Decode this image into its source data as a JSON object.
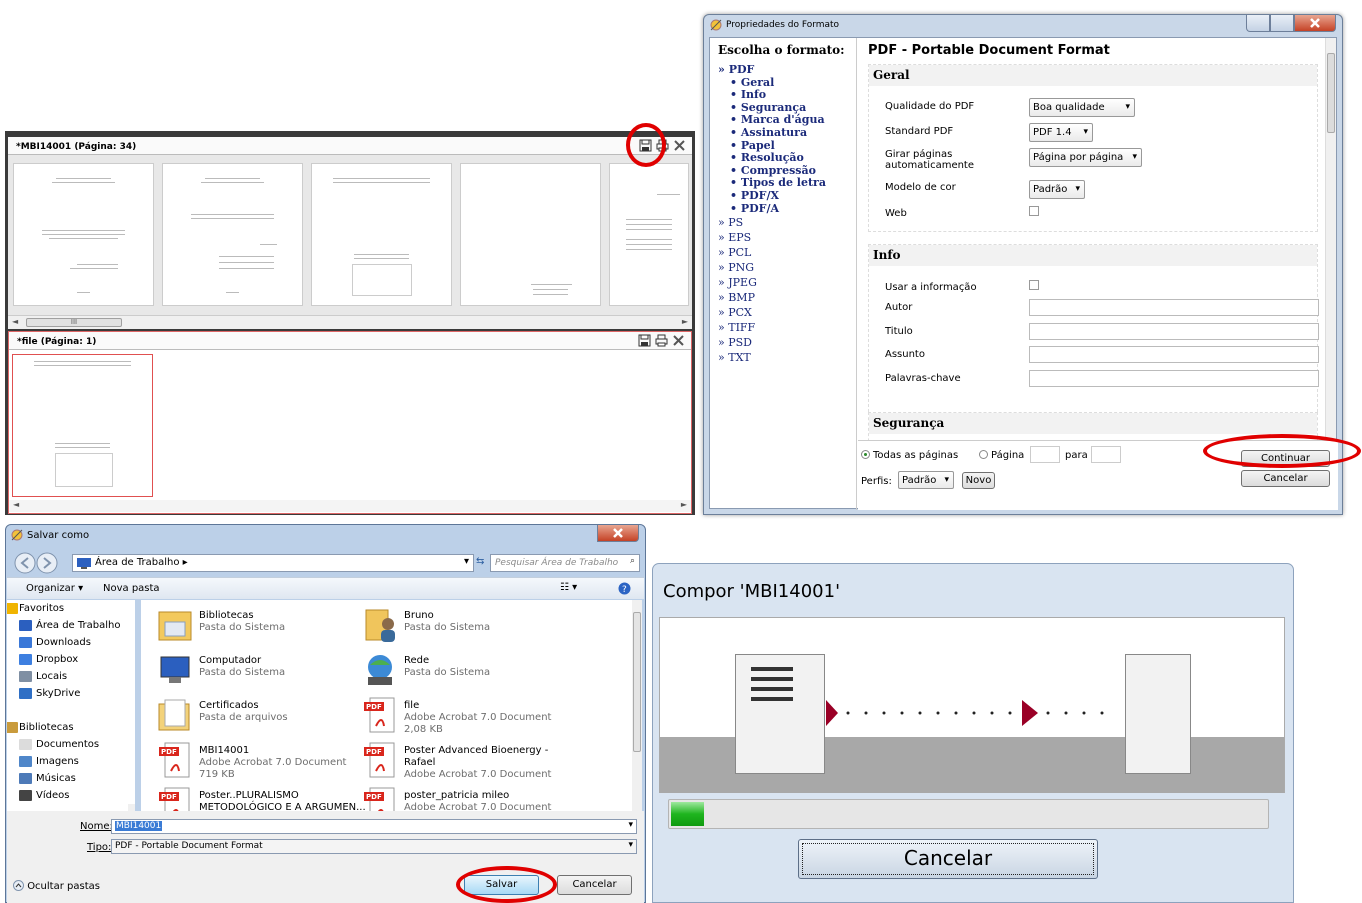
{
  "viewer": {
    "panel1_title": "*MBI14001 (Página: 34)",
    "panel2_title": "*file (Página: 1)",
    "scroll_thumb_glyph": "III",
    "scroll_left_glyph": "◄",
    "scroll_right_glyph": "►"
  },
  "format_dialog": {
    "window_title": "Propriedades do Formato",
    "choose_heading": "Escolha o formato:",
    "formats": [
      {
        "label": "» PDF",
        "bold": true,
        "sub": false
      },
      {
        "label": "• Geral",
        "bold": true,
        "sub": true
      },
      {
        "label": "• Info",
        "bold": true,
        "sub": true
      },
      {
        "label": "• Segurança",
        "bold": true,
        "sub": true
      },
      {
        "label": "• Marca d'água",
        "bold": true,
        "sub": true
      },
      {
        "label": "• Assinatura",
        "bold": true,
        "sub": true
      },
      {
        "label": "• Papel",
        "bold": true,
        "sub": true
      },
      {
        "label": "• Resolução",
        "bold": true,
        "sub": true
      },
      {
        "label": "• Compressão",
        "bold": true,
        "sub": true
      },
      {
        "label": "• Tipos de letra",
        "bold": true,
        "sub": true
      },
      {
        "label": "• PDF/X",
        "bold": true,
        "sub": true
      },
      {
        "label": "• PDF/A",
        "bold": true,
        "sub": true
      },
      {
        "label": "» PS",
        "bold": false,
        "sub": false
      },
      {
        "label": "» EPS",
        "bold": false,
        "sub": false
      },
      {
        "label": "» PCL",
        "bold": false,
        "sub": false
      },
      {
        "label": "» PNG",
        "bold": false,
        "sub": false
      },
      {
        "label": "» JPEG",
        "bold": false,
        "sub": false
      },
      {
        "label": "» BMP",
        "bold": false,
        "sub": false
      },
      {
        "label": "» PCX",
        "bold": false,
        "sub": false
      },
      {
        "label": "» TIFF",
        "bold": false,
        "sub": false
      },
      {
        "label": "» PSD",
        "bold": false,
        "sub": false
      },
      {
        "label": "» TXT",
        "bold": false,
        "sub": false
      }
    ],
    "format_title": "PDF - Portable Document Format",
    "geral": {
      "heading": "Geral",
      "quality_label": "Qualidade do PDF",
      "quality_value": "Boa qualidade",
      "standard_label": "Standard PDF",
      "standard_value": "PDF 1.4",
      "rotate_label": "Girar páginas automaticamente",
      "rotate_value": "Página por página",
      "color_label": "Modelo de cor",
      "color_value": "Padrão",
      "web_label": "Web"
    },
    "info": {
      "heading": "Info",
      "use_info_label": "Usar a informação",
      "author_label": "Autor",
      "title_label": "Titulo",
      "subject_label": "Assunto",
      "keywords_label": "Palavras-chave"
    },
    "security_heading": "Segurança",
    "all_pages_label": "Todas as páginas",
    "page_label": "Página",
    "to_label": "para",
    "profiles_label": "Perfis:",
    "profile_value": "Padrão",
    "new_button": "Novo",
    "continue_button": "Continuar",
    "cancel_button": "Cancelar"
  },
  "save_dialog": {
    "window_title": "Salvar como",
    "address": "Área de Trabalho",
    "address_sep": "▸",
    "search_placeholder": "Pesquisar Área de Trabalho",
    "organize": "Organizar ▾",
    "new_folder": "Nova pasta",
    "tree": [
      {
        "label": "Favoritos",
        "icon": "star-icon",
        "header": true
      },
      {
        "label": "Área de Trabalho",
        "icon": "desktop-icon",
        "header": false
      },
      {
        "label": "Downloads",
        "icon": "downloads-icon",
        "header": false
      },
      {
        "label": "Dropbox",
        "icon": "dropbox-icon",
        "header": false
      },
      {
        "label": "Locais",
        "icon": "places-icon",
        "header": false
      },
      {
        "label": "SkyDrive",
        "icon": "skydrive-icon",
        "header": false
      },
      {
        "label": "",
        "icon": "",
        "header": false
      },
      {
        "label": "Bibliotecas",
        "icon": "libraries-icon",
        "header": true
      },
      {
        "label": "Documentos",
        "icon": "documents-icon",
        "header": false
      },
      {
        "label": "Imagens",
        "icon": "images-icon",
        "header": false
      },
      {
        "label": "Músicas",
        "icon": "music-icon",
        "header": false
      },
      {
        "label": "Vídeos",
        "icon": "videos-icon",
        "header": false
      }
    ],
    "files": [
      {
        "name": "Bibliotecas",
        "line2": "Pasta do Sistema",
        "line3": "",
        "icon": "libraries-icon"
      },
      {
        "name": "Bruno",
        "line2": "Pasta do Sistema",
        "line3": "",
        "icon": "user-folder-icon"
      },
      {
        "name": "Computador",
        "line2": "Pasta do Sistema",
        "line3": "",
        "icon": "computer-icon"
      },
      {
        "name": "Rede",
        "line2": "Pasta do Sistema",
        "line3": "",
        "icon": "network-icon"
      },
      {
        "name": "Certificados",
        "line2": "Pasta de arquivos",
        "line3": "",
        "icon": "folder-icon"
      },
      {
        "name": "file",
        "line2": "Adobe Acrobat 7.0 Document",
        "line3": "2,08 KB",
        "icon": "pdf-icon"
      },
      {
        "name": "MBI14001",
        "line2": "Adobe Acrobat 7.0 Document",
        "line3": "719 KB",
        "icon": "pdf-icon"
      },
      {
        "name": "Poster Advanced Bioenergy -",
        "line2": "Rafael",
        "line3": "Adobe Acrobat 7.0 Document",
        "icon": "pdf-icon"
      },
      {
        "name": "Poster..PLURALISMO",
        "line2": "METODOLÓGICO E A ARGUMEN...",
        "line3": "",
        "icon": "pdf-icon"
      },
      {
        "name": "poster_patricia mileo",
        "line2": "Adobe Acrobat 7.0 Document",
        "line3": "",
        "icon": "pdf-icon"
      }
    ],
    "name_label": "Nome:",
    "name_value": "MBI14001",
    "type_label": "Tipo:",
    "type_value": "PDF - Portable Document Format",
    "hide_folders": "Ocultar pastas",
    "save_button": "Salvar",
    "cancel_button": "Cancelar"
  },
  "compose_dialog": {
    "title": "Compor 'MBI14001'",
    "progress_fraction": 0.055,
    "cancel_button": "Cancelar"
  },
  "colors": {
    "annotation_red": "#e00000",
    "progress_green": "#1fb51f",
    "arrow_red": "#9a0026",
    "link_blue": "#1b2a7a"
  }
}
